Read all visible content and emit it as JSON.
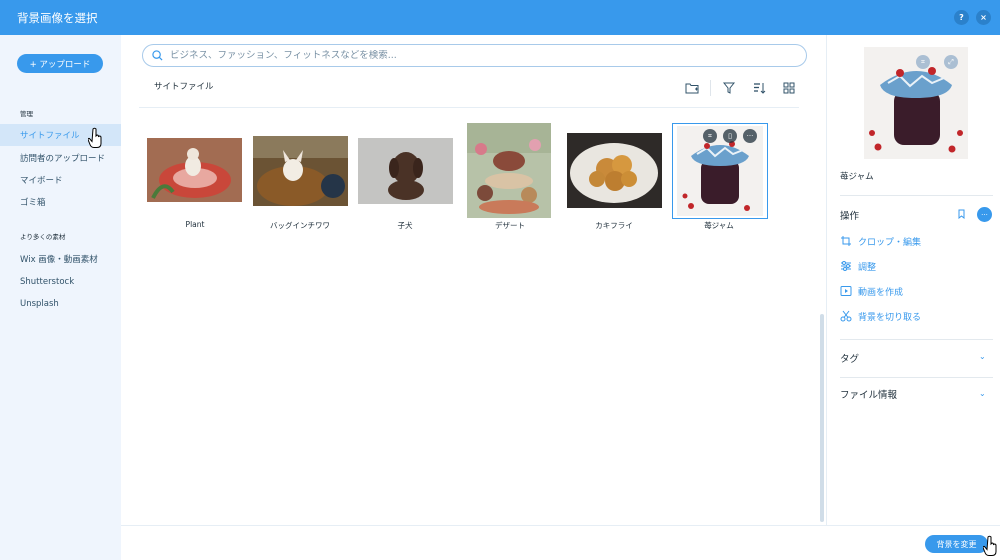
{
  "header": {
    "title": "背景画像を選択",
    "help_label": "?",
    "close_label": "×"
  },
  "colors": {
    "accent": "#3899ec",
    "sidebar_bg": "#eff5fd",
    "active_bg": "#d3e6f9"
  },
  "sidebar": {
    "upload_label": "+ アップロード",
    "section_manage": "管理",
    "manage_items": [
      {
        "label": "サイトファイル",
        "active": true
      },
      {
        "label": "訪問者のアップロード"
      },
      {
        "label": "マイボード"
      },
      {
        "label": "ゴミ箱"
      }
    ],
    "section_more": "より多くの素材",
    "more_items": [
      {
        "label": "Wix 画像・動画素材"
      },
      {
        "label": "Shutterstock"
      },
      {
        "label": "Unsplash"
      }
    ]
  },
  "search": {
    "placeholder": "ビジネス、ファッション、フィットネスなどを検索..."
  },
  "main": {
    "breadcrumb": "サイトファイル",
    "toolbar_icons": [
      "new-folder-icon",
      "filter-icon",
      "sort-icon",
      "grid-view-icon"
    ],
    "files": [
      {
        "label": "Plant"
      },
      {
        "label": "バッグインチワワ"
      },
      {
        "label": "子犬"
      },
      {
        "label": "デザート"
      },
      {
        "label": "カキフライ"
      },
      {
        "label": "苺ジャム",
        "selected": true
      }
    ]
  },
  "details": {
    "file_name": "苺ジャム",
    "actions_heading": "操作",
    "actions": [
      {
        "label": "クロップ・編集",
        "icon": "crop-icon"
      },
      {
        "label": "調整",
        "icon": "sliders-icon"
      },
      {
        "label": "動画を作成",
        "icon": "video-icon"
      },
      {
        "label": "背景を切り取る",
        "icon": "scissors-icon"
      }
    ],
    "tags_heading": "タグ",
    "file_info_heading": "ファイル情報"
  },
  "footer": {
    "change_bg_label": "背景を変更"
  }
}
